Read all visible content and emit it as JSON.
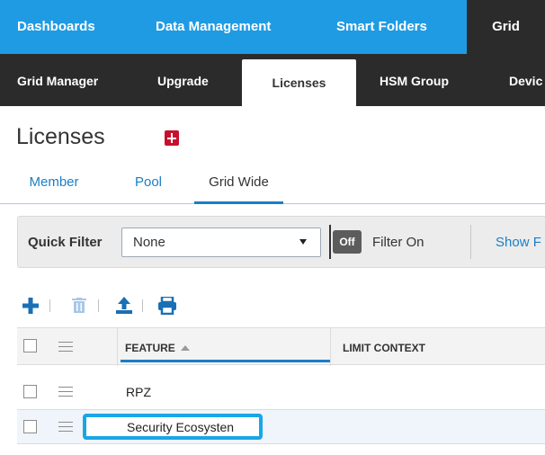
{
  "top_nav": {
    "items": [
      "Dashboards",
      "Data Management",
      "Smart Folders",
      "Grid"
    ],
    "active": "Grid"
  },
  "sub_nav": {
    "items": [
      "Grid Manager",
      "Upgrade",
      "Licenses",
      "HSM Group",
      "Devic"
    ],
    "active": "Licenses"
  },
  "page": {
    "title": "Licenses",
    "bookmark_icon": "add-bookmark-icon"
  },
  "inner_tabs": {
    "items": [
      "Member",
      "Pool",
      "Grid Wide"
    ],
    "active": "Grid Wide"
  },
  "filter_bar": {
    "quick_filter_label": "Quick Filter",
    "quick_filter_value": "None",
    "toggle_label": "Off",
    "filter_on_label": "Filter On",
    "show_link": "Show F"
  },
  "toolbar": {
    "icons": [
      "add-icon",
      "delete-icon",
      "export-icon",
      "print-icon"
    ]
  },
  "table": {
    "columns": [
      "FEATURE",
      "LIMIT CONTEXT"
    ],
    "sort_column": "FEATURE",
    "sort_direction": "ascending",
    "rows": [
      {
        "feature": "RPZ",
        "limit_context": ""
      },
      {
        "feature": "Security Ecosysten",
        "limit_context": ""
      }
    ]
  },
  "colors": {
    "primary_nav": "#1f9be4",
    "secondary_nav": "#2b2b2b",
    "link": "#1a7ec6",
    "bookmark": "#c8102e",
    "edit_highlight": "#1aa6e6"
  }
}
